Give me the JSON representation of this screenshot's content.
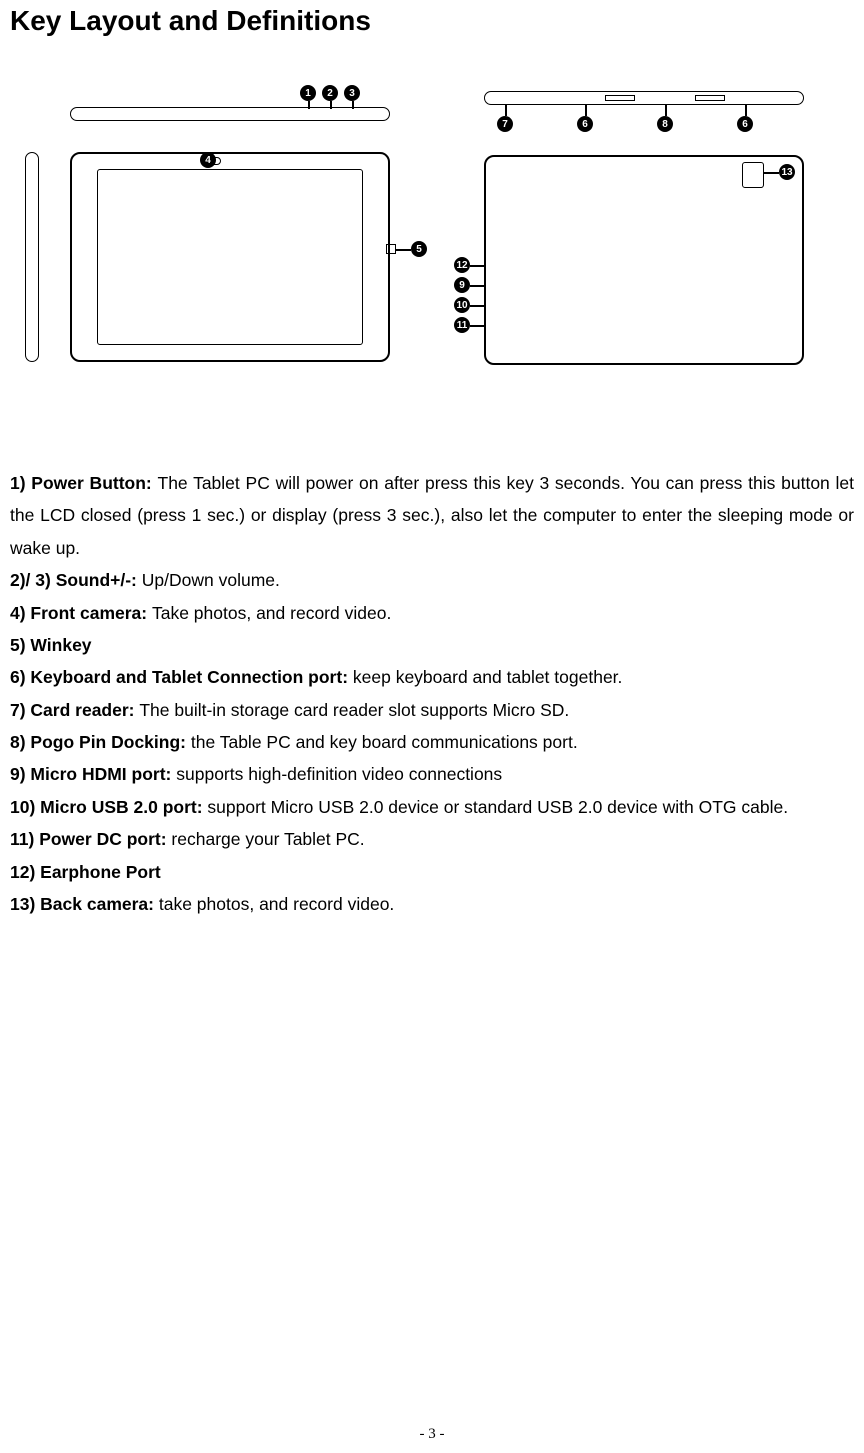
{
  "heading": "Key Layout and Definitions",
  "callouts": {
    "c1": "1",
    "c2": "2",
    "c3": "3",
    "c4": "4",
    "c5": "5",
    "c6": "6",
    "c7": "7",
    "c8": "8",
    "c9": "9",
    "c10": "10",
    "c11": "11",
    "c12": "12",
    "c13": "13"
  },
  "definitions": {
    "d1_label": "1) Power Button: ",
    "d1_text": "The Tablet PC will power on after press this key 3 seconds. You can press this button let the LCD closed (press 1 sec.) or display (press 3 sec.), also let the computer to enter the sleeping mode or wake up.",
    "d2_label": "2)/ 3) Sound+/-: ",
    "d2_text": "Up/Down volume.",
    "d4_label": "4) Front camera: ",
    "d4_text": "Take photos, and record video.",
    "d5_label": "5) Winkey",
    "d6_label": "6) Keyboard and Tablet Connection port: ",
    "d6_text": "keep keyboard and tablet together.",
    "d7_label": "7) Card reader: ",
    "d7_text": "The built-in storage card reader slot supports Micro SD.",
    "d8_label": "8) Pogo Pin Docking: ",
    "d8_text": "the Table PC and key board communications port.",
    "d9_label": "9) Micro HDMI port: ",
    "d9_text": "supports high-definition video connections",
    "d10_label": "10) Micro USB 2.0 port: ",
    "d10_text": "support Micro USB 2.0 device or standard USB 2.0 device with OTG cable.",
    "d11_label": "11) Power DC port: ",
    "d11_text": "recharge your Tablet PC.",
    "d12_label": "12) Earphone Port",
    "d13_label": "13) Back camera: ",
    "d13_text": "take photos, and record video."
  },
  "page_number": "- 3 -"
}
